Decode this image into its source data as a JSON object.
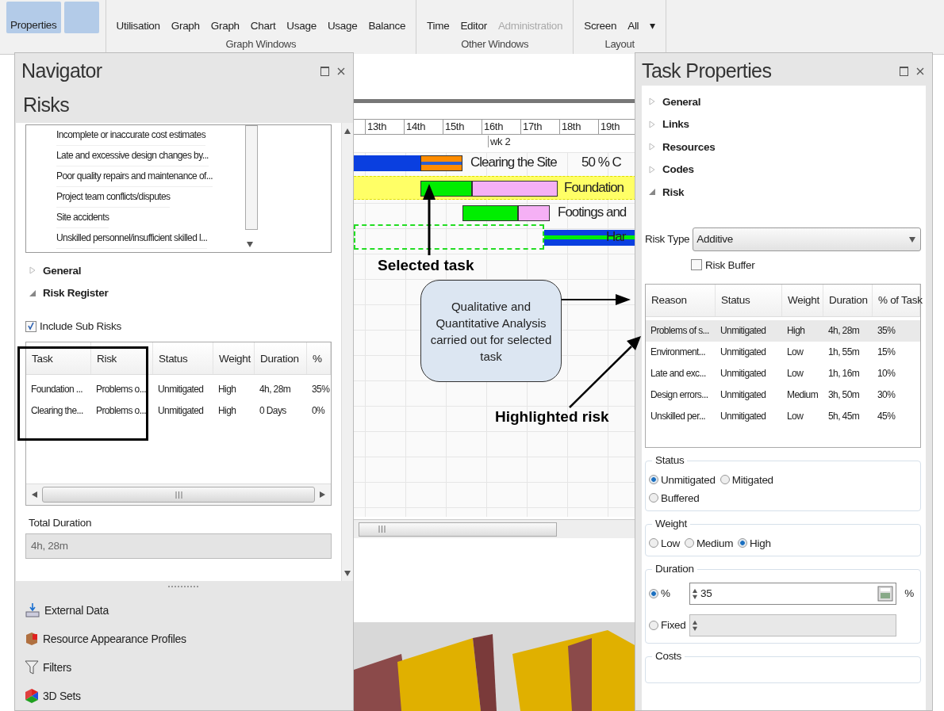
{
  "ribbon": {
    "groups": [
      {
        "buttons": [
          {
            "label": "Properties",
            "selected": true,
            "disabled": false
          },
          {
            "selected": true,
            "disabled": false
          }
        ]
      },
      {
        "label": "Graph Windows",
        "buttons": [
          {
            "label": "Utilisation",
            "disabled": false
          },
          {
            "label": "Graph",
            "disabled": false
          },
          {
            "label": "Graph",
            "disabled": false
          },
          {
            "label": "Chart",
            "disabled": false
          },
          {
            "label": "Usage",
            "disabled": false
          },
          {
            "label": "Usage",
            "disabled": false
          },
          {
            "label": "Balance",
            "disabled": false
          }
        ]
      },
      {
        "label": "Other Windows",
        "buttons": [
          {
            "label": "Time",
            "disabled": false
          },
          {
            "label": "Editor",
            "disabled": false
          },
          {
            "label": "Administration",
            "disabled": true
          }
        ]
      },
      {
        "label": "Layout",
        "buttons": [
          {
            "label": "Screen",
            "disabled": false
          },
          {
            "label": "All",
            "disabled": false
          },
          {
            "label": "▾",
            "disabled": false
          }
        ]
      }
    ]
  },
  "navigator": {
    "title": "Navigator",
    "heading": "Risks",
    "risk_list": [
      "Incomplete or inaccurate cost estimates",
      "Late and excessive design changes by...",
      "Poor quality repairs and maintenance of...",
      "Project team conflicts/disputes",
      "Site accidents",
      "Unskilled personnel/insufficient skilled l..."
    ],
    "sections": [
      {
        "label": "General",
        "expanded": false
      },
      {
        "label": "Risk Register",
        "expanded": true
      }
    ],
    "include_sub_risks": {
      "label": "Include Sub Risks",
      "checked": true
    },
    "register": {
      "columns": [
        "Task",
        "Risk",
        "Status",
        "Weight",
        "Duration",
        "%"
      ],
      "rows": [
        [
          "Foundation ...",
          "Problems o...",
          "Unmitigated",
          "High",
          "4h, 28m",
          "35%"
        ],
        [
          "Clearing the...",
          "Problems o...",
          "Unmitigated",
          "High",
          "0 Days",
          "0%"
        ]
      ]
    },
    "total_duration": {
      "label": "Total Duration",
      "value": "4h, 28m"
    },
    "tools": [
      {
        "label": "External Data",
        "kind": "download"
      },
      {
        "label": "Resource Appearance Profiles",
        "kind": "profile"
      },
      {
        "label": "Filters",
        "kind": "filter"
      },
      {
        "label": "3D Sets",
        "kind": "sets"
      }
    ]
  },
  "gantt": {
    "dates": [
      "13th",
      "14th",
      "15th",
      "16th",
      "17th",
      "18th",
      "19th"
    ],
    "week": "wk 2",
    "tasks": [
      {
        "label": "Clearing the Site",
        "note": "50 % C",
        "selected": false
      },
      {
        "label": "Foundation",
        "selected": true
      },
      {
        "label": "Footings and",
        "selected": false
      },
      {
        "label": "Har",
        "selected": false
      }
    ]
  },
  "task_properties": {
    "title": "Task Properties",
    "sections": [
      {
        "label": "General",
        "expanded": false
      },
      {
        "label": "Links",
        "expanded": false
      },
      {
        "label": "Resources",
        "expanded": false
      },
      {
        "label": "Codes",
        "expanded": false
      },
      {
        "label": "Risk",
        "expanded": true
      }
    ],
    "risk_type": {
      "label": "Risk Type",
      "value": "Additive"
    },
    "risk_buffer": {
      "label": "Risk Buffer",
      "checked": false
    },
    "risks": {
      "columns": [
        "Reason",
        "Status",
        "Weight",
        "Duration",
        "% of Task"
      ],
      "rows": [
        {
          "cells": [
            "Problems of s...",
            "Unmitigated",
            "High",
            "4h, 28m",
            "35%"
          ],
          "selected": true
        },
        {
          "cells": [
            "Environment...",
            "Unmitigated",
            "Low",
            "1h, 55m",
            "15%"
          ],
          "selected": false
        },
        {
          "cells": [
            "Late and exc...",
            "Unmitigated",
            "Low",
            "1h, 16m",
            "10%"
          ],
          "selected": false
        },
        {
          "cells": [
            "Design errors...",
            "Unmitigated",
            "Medium",
            "3h, 50m",
            "30%"
          ],
          "selected": false
        },
        {
          "cells": [
            "Unskilled per...",
            "Unmitigated",
            "Low",
            "5h, 45m",
            "45%"
          ],
          "selected": false
        }
      ]
    },
    "status": {
      "label": "Status",
      "options": [
        {
          "label": "Unmitigated",
          "selected": true
        },
        {
          "label": "Mitigated",
          "selected": false
        },
        {
          "label": "Buffered",
          "selected": false
        }
      ]
    },
    "weight": {
      "label": "Weight",
      "options": [
        {
          "label": "Low",
          "selected": false
        },
        {
          "label": "Medium",
          "selected": false
        },
        {
          "label": "High",
          "selected": true
        }
      ]
    },
    "duration": {
      "label": "Duration",
      "options": [
        {
          "label": "%",
          "selected": true,
          "value": "35",
          "unit": "%"
        },
        {
          "label": "Fixed",
          "selected": false
        }
      ]
    },
    "costs": {
      "label": "Costs"
    }
  },
  "annotations": {
    "selected_task": "Selected task",
    "callout": "Qualitative and Quantitative Analysis carried out for selected task",
    "highlighted_risk": "Highlighted risk"
  }
}
